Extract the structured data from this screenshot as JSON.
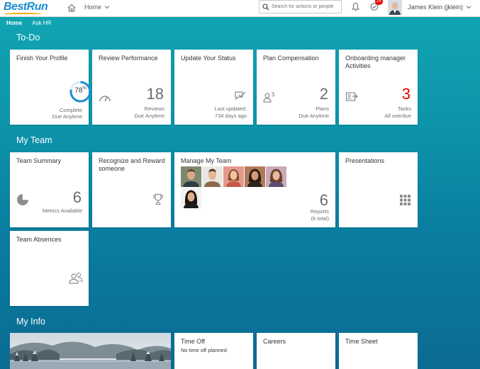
{
  "header": {
    "logo": "BestRun",
    "home_menu": "Home",
    "search_placeholder": "Search for actions or people",
    "tasks_badge": "25",
    "user": "James Klein (jklein)"
  },
  "nav": {
    "tabs": [
      "Home",
      "Ask HR"
    ]
  },
  "sections": {
    "todo": "To-Do",
    "my_team": "My Team",
    "my_info": "My Info"
  },
  "todo": {
    "profile": {
      "title": "Finish Your Profile",
      "progress_value": 78,
      "progress_number": "78",
      "progress_unit": "%",
      "unit": "Complete",
      "footer": "Due Anytime"
    },
    "performance": {
      "title": "Review Performance",
      "value": "18",
      "unit": "Reviews",
      "footer": "Due Anytime"
    },
    "status": {
      "title": "Update Your Status",
      "unit": "Last updated:",
      "footer": "734 days ago"
    },
    "compensation": {
      "title": "Plan Compensation",
      "value": "2",
      "unit": "Plans",
      "footer": "Due Anytime"
    },
    "onboarding": {
      "title": "Onboarding manager Activities",
      "value": "3",
      "unit": "Tasks",
      "footer": "All overdue",
      "value_color": "#e00000"
    }
  },
  "team": {
    "summary": {
      "title": "Team Summary",
      "value": "6",
      "unit": "Metrics Available"
    },
    "recognize": {
      "title": "Recognize and Reward someone"
    },
    "manage": {
      "title": "Manage My Team",
      "value": "6",
      "unit": "Reports",
      "footer": "(6 total)"
    },
    "presentations": {
      "title": "Presentations"
    },
    "absences": {
      "title": "Team Absences"
    }
  },
  "info": {
    "timeoff": {
      "title": "Time Off",
      "subtitle": "No time off planned"
    },
    "careers": {
      "title": "Careers"
    },
    "timesheet": {
      "title": "Time Sheet"
    }
  },
  "colors": {
    "accent": "#1c8cd1",
    "background": "#0d93a9",
    "negative": "#e00000"
  }
}
